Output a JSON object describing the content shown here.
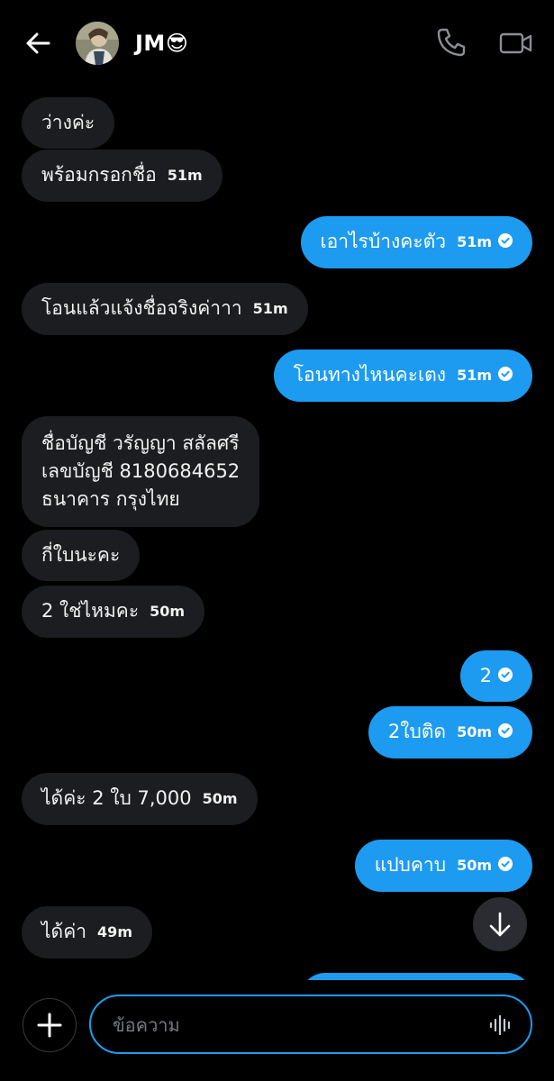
{
  "header": {
    "contact_name": "JM😎",
    "back_icon": "arrow-left-icon",
    "call_icon": "phone-icon",
    "video_icon": "video-camera-icon"
  },
  "messages": [
    {
      "direction": "in",
      "text": "ว่างค่ะ",
      "time": ""
    },
    {
      "direction": "in",
      "text": "พร้อมกรอกชื่อ",
      "time": "51m"
    },
    {
      "direction": "out",
      "text": "เอาไรบ้างคะตัว",
      "time": "51m"
    },
    {
      "direction": "in",
      "text": "โอนแล้วแจ้งชื่อจริงค่าาา",
      "time": "51m"
    },
    {
      "direction": "out",
      "text": "โอนทางไหนคะเตง",
      "time": "51m"
    },
    {
      "direction": "in",
      "lines": [
        "ชื่อบัญชี วรัญญา สลัลศรี",
        "เลขบัญชี 8180684652",
        "ธนาคาร กรุงไทย"
      ],
      "time": ""
    },
    {
      "direction": "in",
      "text": "กี่ใบนะคะ",
      "time": ""
    },
    {
      "direction": "in",
      "text": "2 ใช่ไหมคะ",
      "time": "50m"
    },
    {
      "direction": "out",
      "text": "2",
      "time": ""
    },
    {
      "direction": "out",
      "text": "2ใบติด",
      "time": "50m"
    },
    {
      "direction": "in",
      "text": "ได้ค่ะ 2 ใบ 7,000",
      "time": "50m"
    },
    {
      "direction": "out",
      "text": "แปบคาบ",
      "time": "50m"
    },
    {
      "direction": "in",
      "text": "ได้ค่า",
      "time": "49m"
    }
  ],
  "composer": {
    "placeholder": "ข้อความ",
    "add_icon": "plus-icon",
    "voice_icon": "voice-waveform-icon"
  },
  "colors": {
    "background": "#000000",
    "incoming_bubble": "#1c1d21",
    "outgoing_bubble": "#1d9bf0",
    "accent": "#1d9bf0"
  }
}
